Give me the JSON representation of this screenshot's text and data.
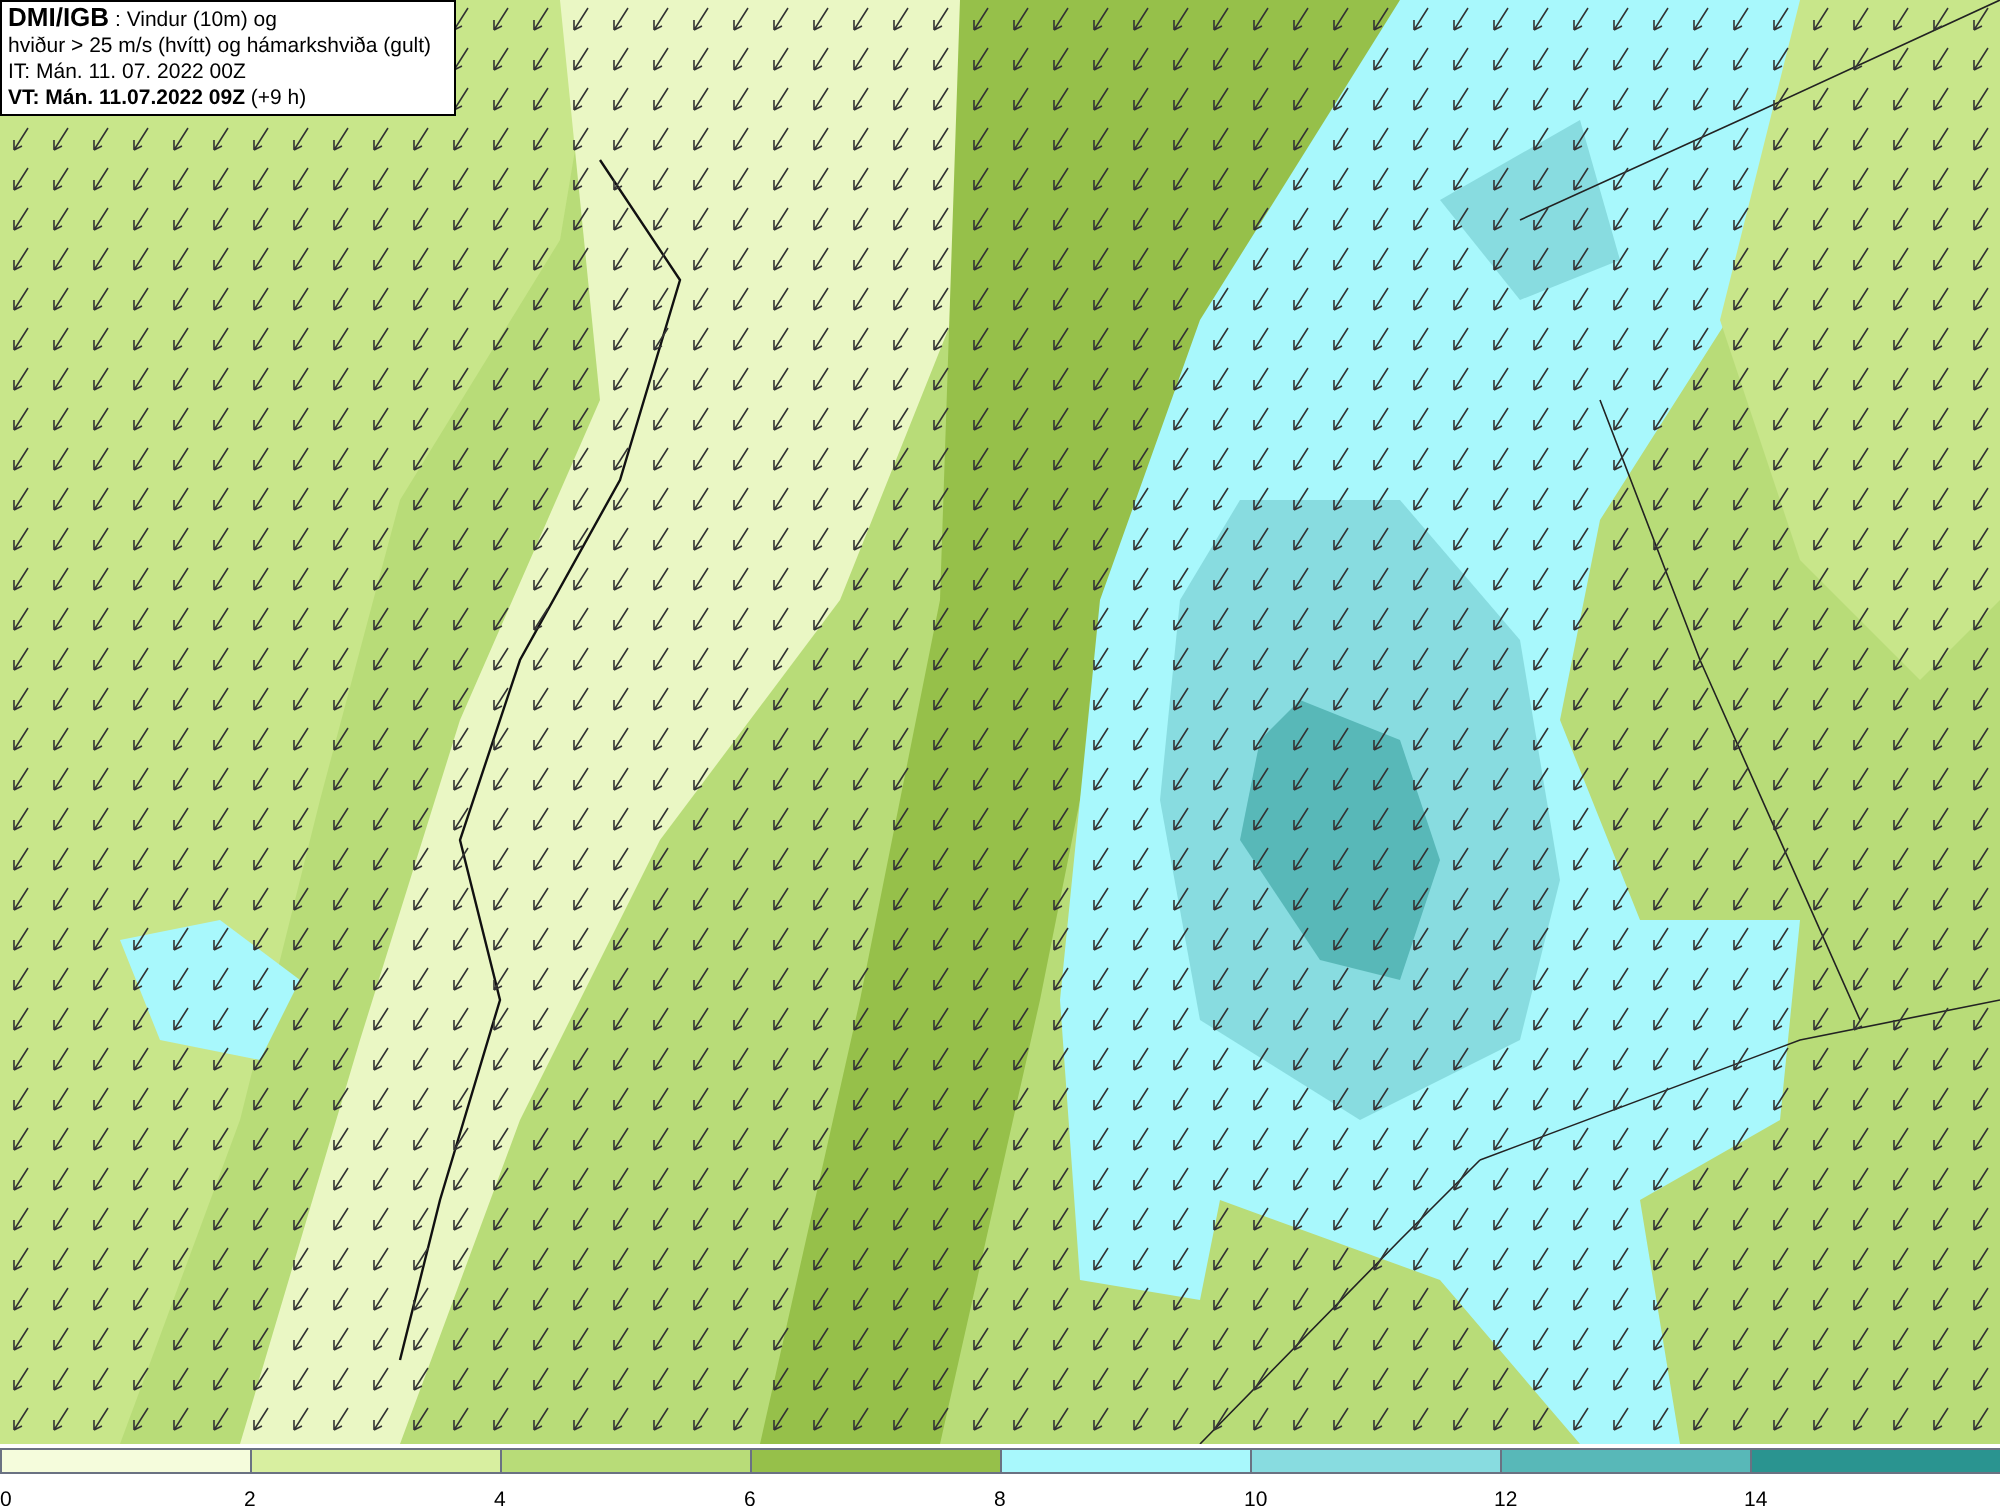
{
  "title_box": {
    "source": "DMI/IGB",
    "description": ": Vindur (10m) og",
    "line_2": "hviður > 25 m/s (hvítt) og hámarkshviða (gult)",
    "issue_time": "IT: Mán. 11. 07. 2022 00Z",
    "valid_time": "VT: Mán. 11.07.2022 09Z",
    "lead_time": "(+9 h)"
  },
  "legend": {
    "bins": [
      {
        "color": "#f5fcdc"
      },
      {
        "color": "#d8efa0"
      },
      {
        "color": "#b8dc78"
      },
      {
        "color": "#96c04a"
      },
      {
        "color": "#a8f8fc"
      },
      {
        "color": "#88dce0"
      },
      {
        "color": "#58b8b8"
      },
      {
        "color": "#2a9490"
      }
    ],
    "ticks": [
      "0",
      "2",
      "4",
      "6",
      "8",
      "10",
      "12",
      "14"
    ]
  }
}
